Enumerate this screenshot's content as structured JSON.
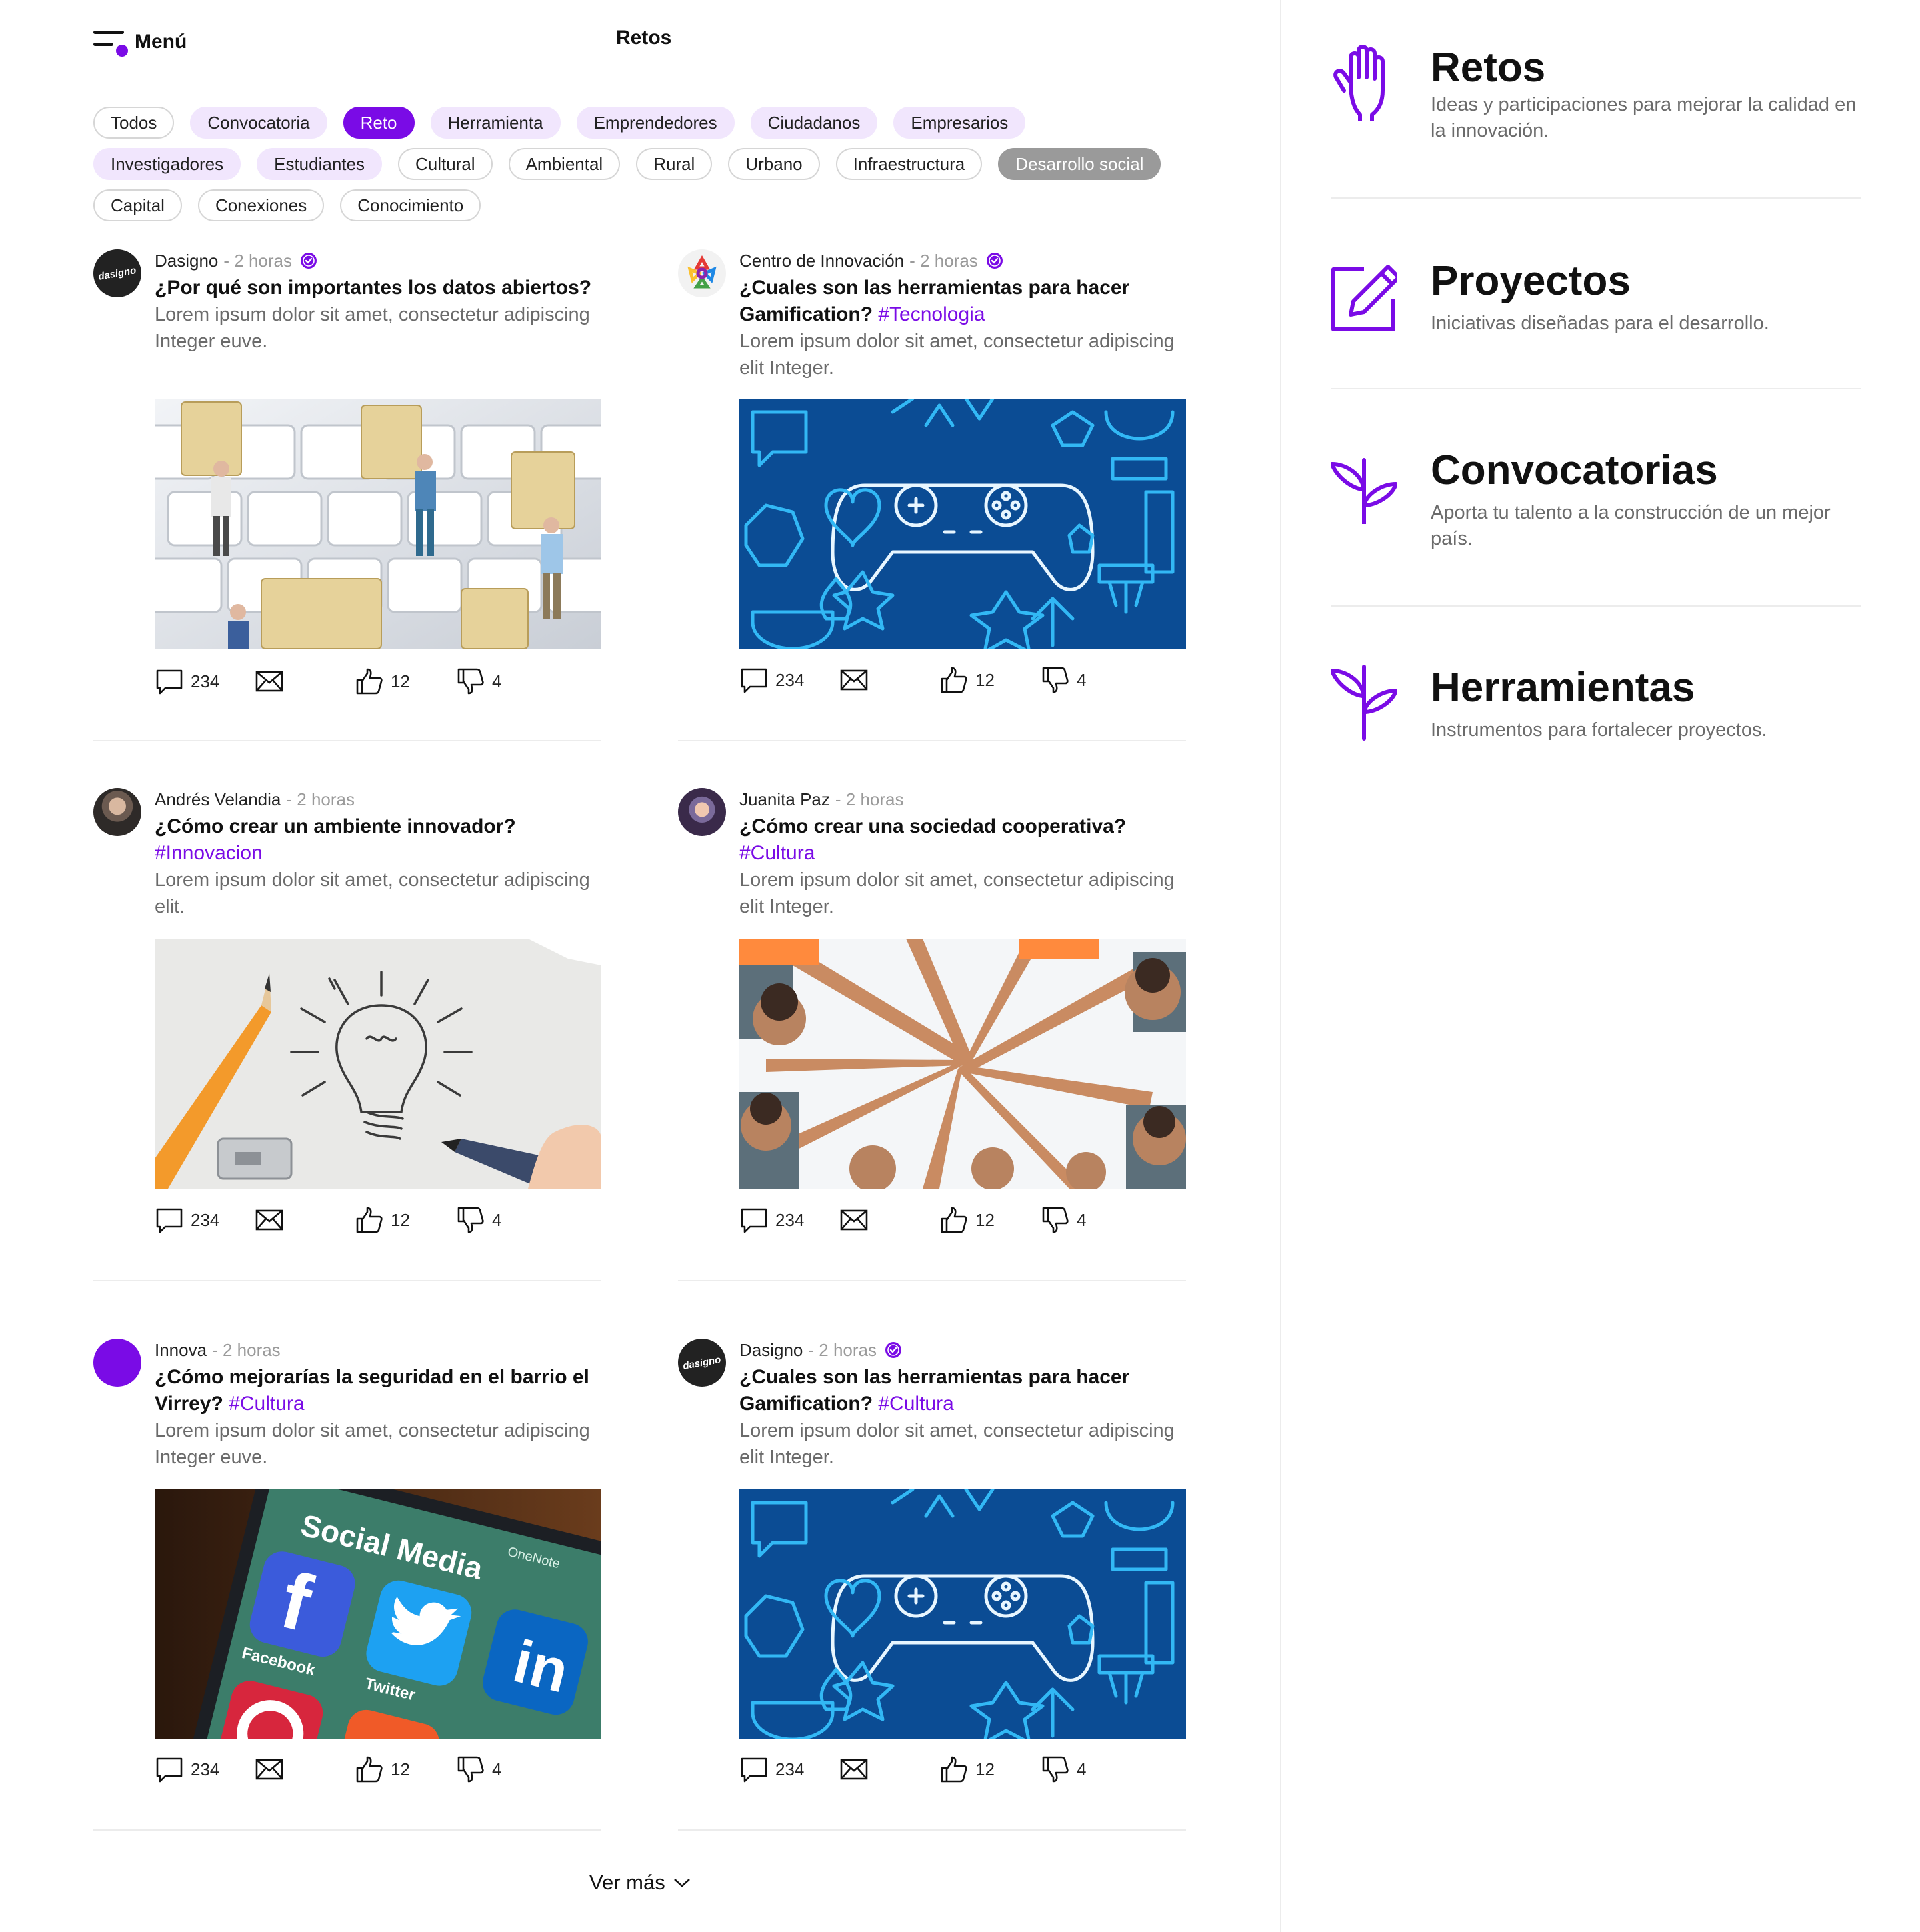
{
  "header": {
    "menu_label": "Menú",
    "page_title": "Retos"
  },
  "filters": {
    "rows": [
      [
        {
          "label": "Todos",
          "style": "outline"
        },
        {
          "label": "Convocatoria",
          "style": "soft"
        },
        {
          "label": "Reto",
          "style": "active"
        },
        {
          "label": "Herramienta",
          "style": "soft"
        },
        {
          "label": "Emprendedores",
          "style": "soft"
        },
        {
          "label": "Ciudadanos",
          "style": "soft"
        },
        {
          "label": "Empresarios",
          "style": "soft"
        }
      ],
      [
        {
          "label": "Investigadores",
          "style": "soft"
        },
        {
          "label": "Estudiantes",
          "style": "soft"
        },
        {
          "label": "Cultural",
          "style": "outline"
        },
        {
          "label": "Ambiental",
          "style": "outline"
        },
        {
          "label": "Rural",
          "style": "outline"
        },
        {
          "label": "Urbano",
          "style": "outline"
        },
        {
          "label": "Infraestructura",
          "style": "outline"
        },
        {
          "label": "Desarrollo social",
          "style": "disabled"
        }
      ],
      [
        {
          "label": "Capital",
          "style": "outline"
        },
        {
          "label": "Conexiones",
          "style": "outline"
        },
        {
          "label": "Conocimiento",
          "style": "outline"
        }
      ]
    ]
  },
  "posts": [
    {
      "author": "Dasigno",
      "time": "- 2 horas",
      "verified": true,
      "avatar_text": "dasigno",
      "title": "¿Por qué son importantes los datos abiertos?",
      "hashtag": "",
      "desc": "Lorem ipsum dolor sit amet, consectetur adipiscing Integer euve.",
      "image": "miniatures-keyboard",
      "comments": "234",
      "likes": "12",
      "dislikes": "4"
    },
    {
      "author": "Centro de Innovación",
      "time": "- 2 horas",
      "verified": true,
      "avatar_text": "",
      "title": "¿Cuales son las herramientas para hacer Gamification?",
      "hashtag": "#Tecnologia",
      "desc": "Lorem ipsum dolor sit amet, consectetur adipiscing elit Integer.",
      "image": "gamepad-pattern",
      "comments": "234",
      "likes": "12",
      "dislikes": "4"
    },
    {
      "author": "Andrés Velandia",
      "time": "- 2 horas",
      "verified": false,
      "avatar_text": "",
      "title": "¿Cómo crear un ambiente innovador?",
      "hashtag": "#Innovacion",
      "desc": "Lorem ipsum dolor sit amet, consectetur adipiscing elit.",
      "image": "lightbulb-sketch",
      "comments": "234",
      "likes": "12",
      "dislikes": "4"
    },
    {
      "author": "Juanita Paz",
      "time": "- 2 horas",
      "verified": false,
      "avatar_text": "",
      "title": "¿Cómo crear una sociedad cooperativa?",
      "hashtag": "#Cultura",
      "desc": "Lorem ipsum dolor sit amet, consectetur adipiscing elit Integer.",
      "image": "team-hands",
      "comments": "234",
      "likes": "12",
      "dislikes": "4"
    },
    {
      "author": "Innova",
      "time": "- 2 horas",
      "verified": false,
      "avatar_text": "",
      "title": "¿Cómo mejorarías la seguridad en el barrio el Virrey?",
      "hashtag": "#Cultura",
      "desc": "Lorem ipsum dolor sit amet, consectetur adipiscing Integer euve.",
      "image": "social-media-phone",
      "comments": "234",
      "likes": "12",
      "dislikes": "4"
    },
    {
      "author": "Dasigno",
      "time": "- 2 horas",
      "verified": true,
      "avatar_text": "dasigno",
      "title": "¿Cuales son las herramientas para hacer Gamification?",
      "hashtag": "#Cultura",
      "desc": "Lorem ipsum dolor sit amet, consectetur adipiscing elit Integer.",
      "image": "gamepad-pattern",
      "comments": "234",
      "likes": "12",
      "dislikes": "4"
    }
  ],
  "social_image": {
    "title": "Social Media",
    "apps": [
      "Facebook",
      "Twitter",
      "OneNote"
    ]
  },
  "see_more": "Ver más",
  "sidebar": [
    {
      "title": "Retos",
      "desc": "Ideas  y participaciones para mejorar la calidad en la innovación.",
      "icon": "hand-icon"
    },
    {
      "title": "Proyectos",
      "desc": "Iniciativas diseñadas para el desarrollo.",
      "icon": "edit-square-icon"
    },
    {
      "title": "Convocatorias",
      "desc": "Aporta tu talento a la construcción de un mejor país.",
      "icon": "sprout-icon"
    },
    {
      "title": "Herramientas",
      "desc": "Instrumentos para fortalecer proyectos.",
      "icon": "sprout-icon"
    }
  ],
  "colors": {
    "accent": "#7A0BE6",
    "chip_soft": "#F1E6FD",
    "chip_disabled": "#9A9A9A",
    "muted_text": "#6b6b6b",
    "game_bg": "#0B4C94",
    "game_line": "#32B8F5"
  }
}
